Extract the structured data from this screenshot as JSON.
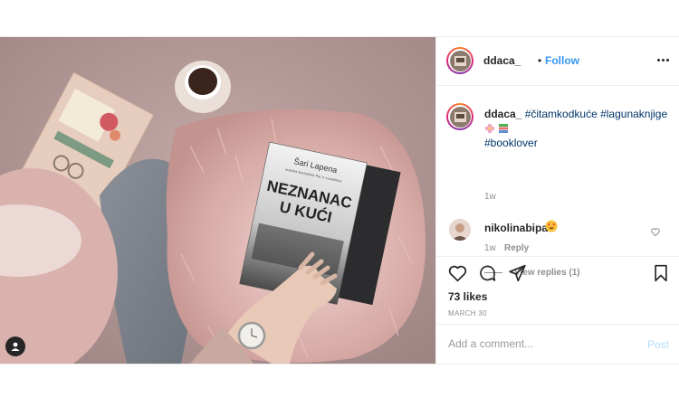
{
  "post": {
    "username": "ddaca_",
    "separator": "•",
    "follow_label": "Follow",
    "caption": {
      "username": "ddaca_",
      "hashtags": [
        "#čitamkodkuće",
        "#lagunaknjige",
        "#booklover"
      ],
      "time": "1w"
    },
    "comments": [
      {
        "username": "nikolinabipa",
        "emoji": "heart-eyes-emoji",
        "time": "1w",
        "reply_label": "Reply",
        "view_replies": "View replies (1)"
      }
    ],
    "likes": "73 likes",
    "date": "MARCH 30",
    "add_comment_placeholder": "Add a comment...",
    "post_label": "Post",
    "photo": {
      "book_author": "Šari Lapena",
      "book_subtitle": "autorka bestselera Par iz susedstva",
      "book_title_line1": "NEZNANAC",
      "book_title_line2": "U KUĆI"
    }
  },
  "icons": {
    "heart": "heart-icon",
    "comment": "comment-icon",
    "share": "share-icon",
    "save": "bookmark-icon",
    "more": "more-options-icon",
    "user_tag": "user-tag-icon"
  },
  "colors": {
    "link": "#3897f0",
    "hashtag": "#003569",
    "muted": "#8e8e8e",
    "post_disabled": "#b2dffc"
  }
}
